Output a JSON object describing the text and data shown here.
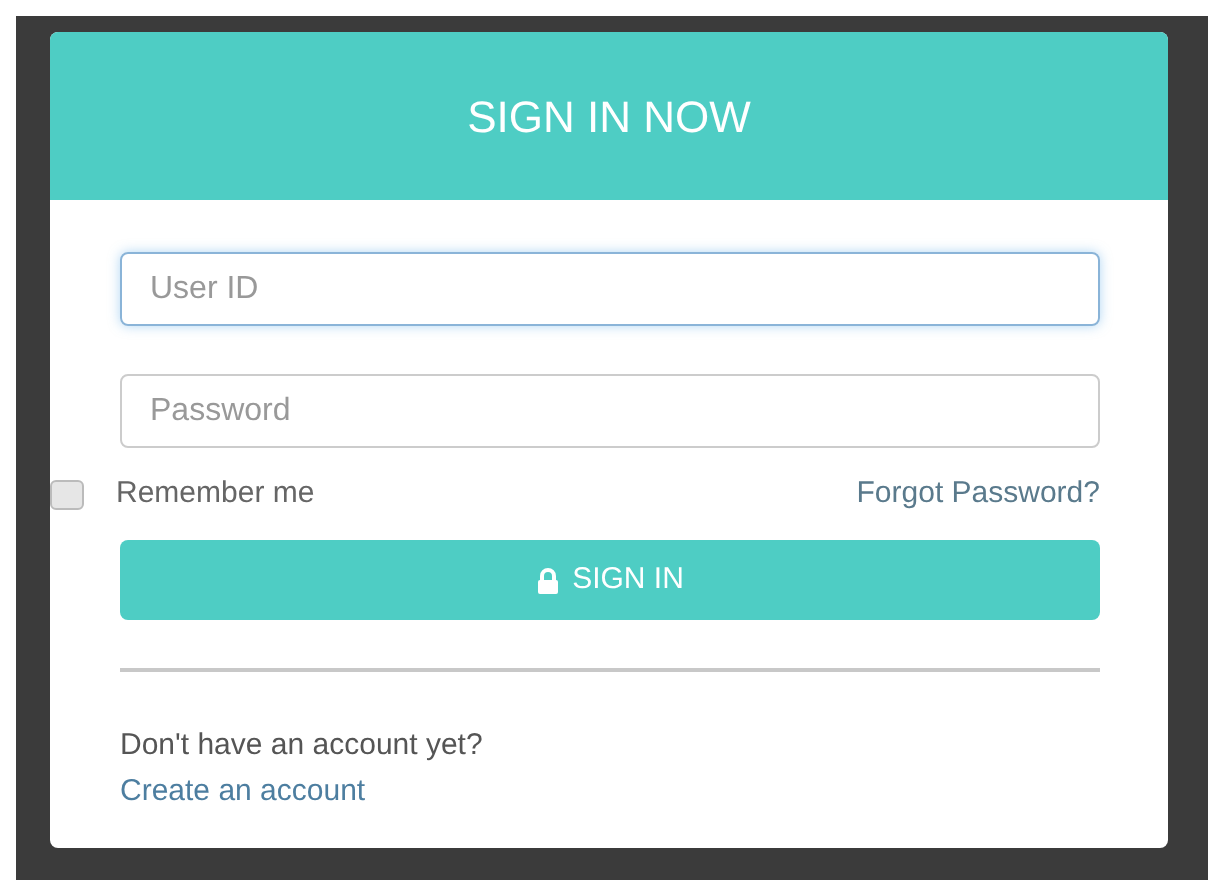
{
  "dialog": {
    "title": "SIGN IN NOW"
  },
  "fields": [
    {
      "placeholder": "User ID",
      "focused": true
    },
    {
      "placeholder": "Password",
      "focused": false
    }
  ],
  "remember": {
    "label": "Remember me",
    "checked": false
  },
  "forgot_link": "Forgot Password?",
  "sign_in_button": "SIGN IN",
  "signup_prompt": "Don't have an account yet?",
  "signup_link": "Create an account"
}
